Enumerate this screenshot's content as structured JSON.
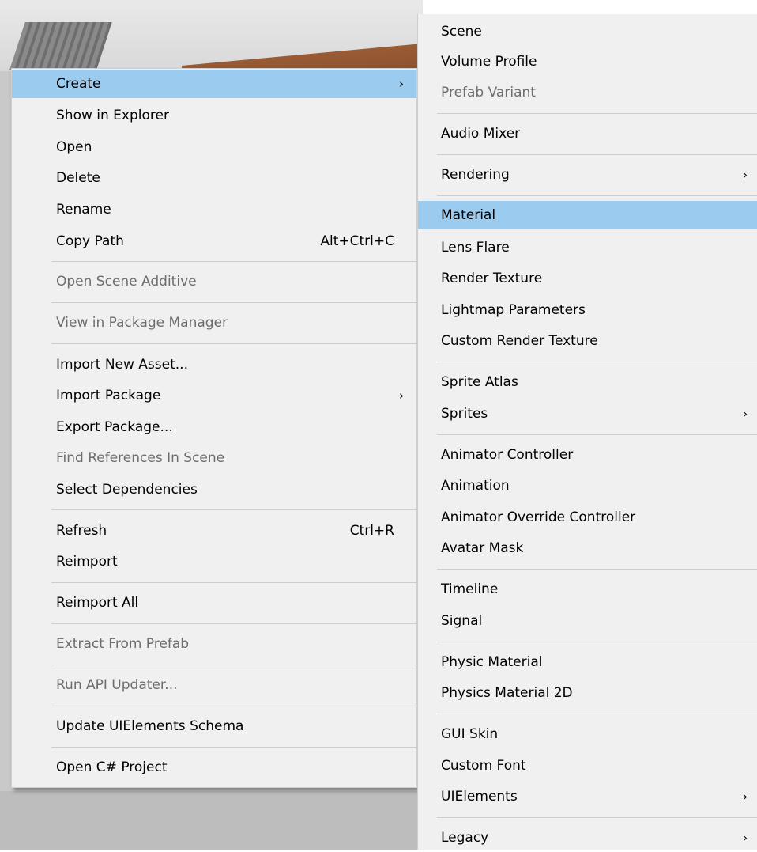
{
  "main_menu": {
    "items": [
      {
        "label": "Create",
        "arrow": "›"
      },
      {
        "label": "Show in Explorer"
      },
      {
        "label": "Open"
      },
      {
        "label": "Delete"
      },
      {
        "label": "Rename"
      },
      {
        "label": "Copy Path",
        "shortcut": "Alt+Ctrl+C"
      },
      {
        "label": "Open Scene Additive"
      },
      {
        "label": "View in Package Manager"
      },
      {
        "label": "Import New Asset..."
      },
      {
        "label": "Import Package",
        "arrow": "›"
      },
      {
        "label": "Export Package..."
      },
      {
        "label": "Find References In Scene"
      },
      {
        "label": "Select Dependencies"
      },
      {
        "label": "Refresh",
        "shortcut": "Ctrl+R"
      },
      {
        "label": "Reimport"
      },
      {
        "label": "Reimport All"
      },
      {
        "label": "Extract From Prefab"
      },
      {
        "label": "Run API Updater..."
      },
      {
        "label": "Update UIElements Schema"
      },
      {
        "label": "Open C# Project"
      }
    ]
  },
  "create_submenu": {
    "items": [
      {
        "label": "Scene"
      },
      {
        "label": "Volume Profile"
      },
      {
        "label": "Prefab Variant"
      },
      {
        "label": "Audio Mixer"
      },
      {
        "label": "Rendering",
        "arrow": "›"
      },
      {
        "label": "Material"
      },
      {
        "label": "Lens Flare"
      },
      {
        "label": "Render Texture"
      },
      {
        "label": "Lightmap Parameters"
      },
      {
        "label": "Custom Render Texture"
      },
      {
        "label": "Sprite Atlas"
      },
      {
        "label": "Sprites",
        "arrow": "›"
      },
      {
        "label": "Animator Controller"
      },
      {
        "label": "Animation"
      },
      {
        "label": "Animator Override Controller"
      },
      {
        "label": "Avatar Mask"
      },
      {
        "label": "Timeline"
      },
      {
        "label": "Signal"
      },
      {
        "label": "Physic Material"
      },
      {
        "label": "Physics Material 2D"
      },
      {
        "label": "GUI Skin"
      },
      {
        "label": "Custom Font"
      },
      {
        "label": "UIElements",
        "arrow": "›"
      },
      {
        "label": "Legacy",
        "arrow": "›"
      }
    ]
  },
  "colors": {
    "menu_bg": "#f0f0f0",
    "highlight": "#9ccbf0",
    "disabled_text": "#6d6d6d",
    "separator": "#cdcdcd"
  }
}
